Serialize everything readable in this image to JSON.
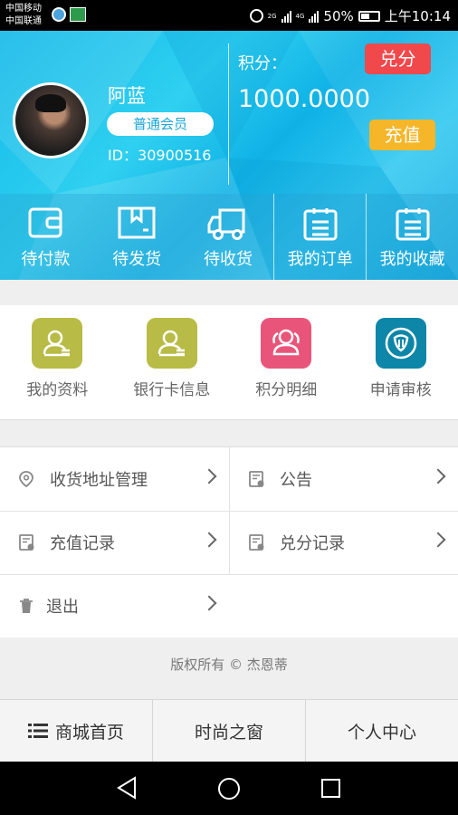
{
  "status_bar": {
    "carrier1": "中国移动",
    "carrier2": "中国联通",
    "net1": "2G",
    "net2": "4G",
    "battery": "50%",
    "time": "上午10:14"
  },
  "profile": {
    "name": "阿蓝",
    "level": "普通会员",
    "id_text": "ID：30900516",
    "points_label": "积分：",
    "points_value": "1000.0000",
    "redeem_button": "兑分",
    "recharge_button": "充值"
  },
  "orders": [
    {
      "label": "待付款",
      "icon": "wallet-icon"
    },
    {
      "label": "待发货",
      "icon": "package-icon"
    },
    {
      "label": "待收货",
      "icon": "truck-icon"
    },
    {
      "label": "我的订单",
      "icon": "list-doc-icon"
    },
    {
      "label": "我的收藏",
      "icon": "list-doc-icon"
    }
  ],
  "quick_links": [
    {
      "label": "我的资料",
      "icon": "user-card-icon",
      "color": "#b8bb45"
    },
    {
      "label": "银行卡信息",
      "icon": "user-card-icon",
      "color": "#b8bb45"
    },
    {
      "label": "积分明细",
      "icon": "users-icon",
      "color": "#e9557a"
    },
    {
      "label": "申请审核",
      "icon": "shield-icon",
      "color": "#0d86a8"
    }
  ],
  "menu": {
    "address": "收货地址管理",
    "notice": "公告",
    "recharge_log": "充值记录",
    "redeem_log": "兑分记录",
    "logout": "退出"
  },
  "copyright": "版权所有 © 杰恩蒂",
  "tabs": [
    "商城首页",
    "时尚之窗",
    "个人中心"
  ],
  "colors": {
    "header_blue": "#1ab6e8",
    "redeem_red": "#f1484b",
    "recharge_orange": "#f5b62a"
  }
}
